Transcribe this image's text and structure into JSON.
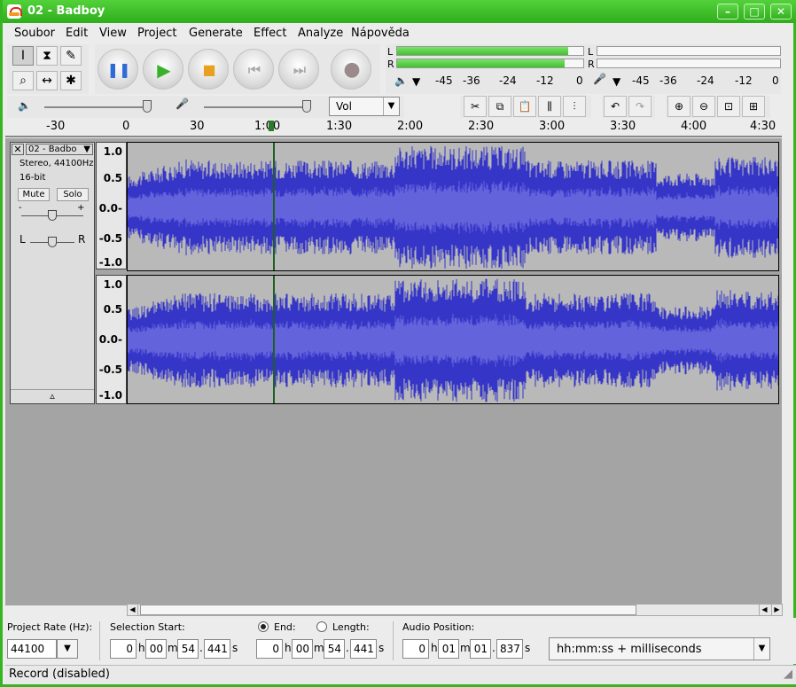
{
  "window": {
    "title": "02 - Badboy",
    "min": "–",
    "max": "□",
    "close": "✕"
  },
  "menu": [
    "Soubor",
    "Edit",
    "View",
    "Project",
    "Generate",
    "Effect",
    "Analyze",
    "Nápověda"
  ],
  "meters": {
    "playback_scale": [
      "-45",
      "-36",
      "-24",
      "-12",
      "0"
    ],
    "record_scale": [
      "-45",
      "-36",
      "-24",
      "-12",
      "0"
    ],
    "channel_left": "L",
    "channel_right": "R",
    "playback_level_left": 0.92,
    "playback_level_right": 0.9
  },
  "mixer": {
    "volume": 0.97,
    "input_volume": 0.97,
    "input_source": "Vol"
  },
  "timeline": {
    "ticks": [
      "-30",
      "0",
      "30",
      "1:00",
      "1:30",
      "2:00",
      "2:30",
      "3:00",
      "3:30",
      "4:00",
      "4:30"
    ]
  },
  "track": {
    "name": "02 - Badbo",
    "format": "Stereo, 44100Hz",
    "bits": "16-bit",
    "mute": "Mute",
    "solo": "Solo",
    "gain_minus": "-",
    "gain_plus": "+",
    "pan_left": "L",
    "pan_right": "R",
    "collapse": "▵",
    "scale": [
      "1.0",
      "0.5",
      "0.0-",
      "-0.5",
      "-1.0"
    ]
  },
  "selection": {
    "project_rate_label": "Project Rate (Hz):",
    "project_rate": "44100",
    "start_label": "Selection Start:",
    "end_label": "End:",
    "length_label": "Length:",
    "audio_position_label": "Audio Position:",
    "start": {
      "h": "0",
      "m": "00",
      "s": "54",
      "ms": "441"
    },
    "end": {
      "h": "0",
      "m": "00",
      "s": "54",
      "ms": "441"
    },
    "position": {
      "h": "0",
      "m": "01",
      "s": "01",
      "ms": "837"
    },
    "unit_h": "h",
    "unit_m": "m",
    "unit_s": "s",
    "format": "hh:mm:ss + milliseconds"
  },
  "status": "Record (disabled)",
  "colors": {
    "titlebar": "#3cbf27",
    "wave": "#3535c8",
    "wave_rms": "#6363dc"
  }
}
